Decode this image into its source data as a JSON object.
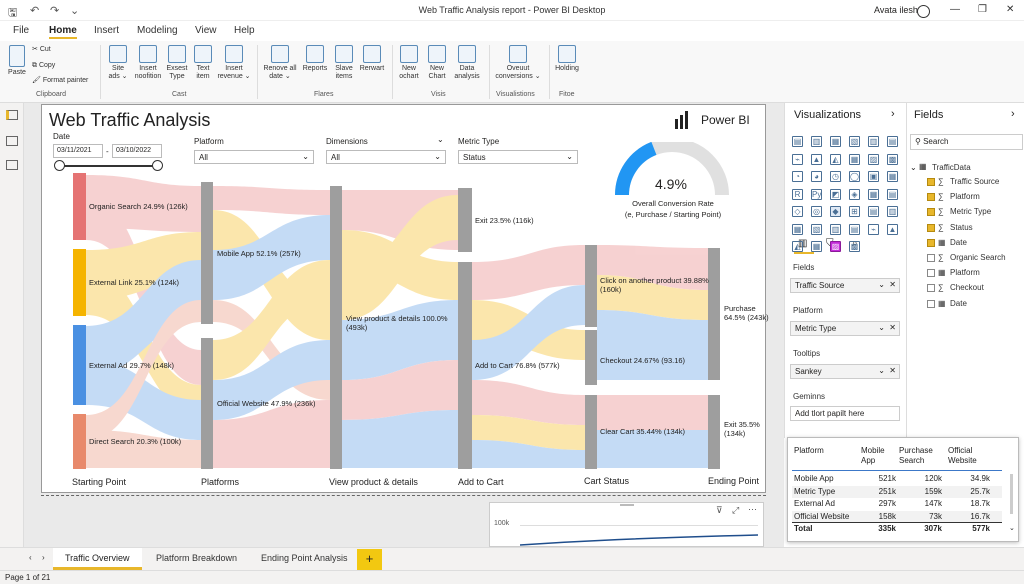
{
  "window": {
    "title": "Web Traffic Analysis report - Power BI Desktop",
    "user": "Avata ilesh"
  },
  "menu": [
    "File",
    "Home",
    "Insert",
    "Modeling",
    "View",
    "Help"
  ],
  "ribbon": {
    "clipboard": {
      "paste": "Paste",
      "cut": "Cut",
      "copy": "Copy",
      "format_painter": "Format painter",
      "group": "Clipboard"
    },
    "cast": [
      {
        "l1": "Site",
        "l2": "ads"
      },
      {
        "l1": "Insert",
        "l2": "noofition"
      },
      {
        "l1": "Exsest",
        "l2": "Type"
      },
      {
        "l1": "Text",
        "l2": "item"
      },
      {
        "l1": "Insert",
        "l2": "revenue"
      }
    ],
    "cast_group": "Cast",
    "flares": [
      {
        "l1": "Renove all",
        "l2": "date"
      },
      {
        "l1": "Reports",
        "l2": ""
      },
      {
        "l1": "Slave",
        "l2": "items"
      },
      {
        "l1": "Rerwart",
        "l2": ""
      }
    ],
    "flares_group": "Flares",
    "visis": [
      {
        "l1": "New",
        "l2": "ochart"
      },
      {
        "l1": "New",
        "l2": "Chart"
      },
      {
        "l1": "Data",
        "l2": "analysis"
      }
    ],
    "visis_group": "Visis",
    "visualistions": {
      "l1": "Oveuut",
      "l2": "conversions",
      "group": "Visualistions"
    },
    "fitoe": {
      "l1": "Holding",
      "group": "Fitoe"
    }
  },
  "report": {
    "title": "Web Traffic Analysis",
    "brand": "Power BI",
    "date_label": "Date",
    "date_from": "03/11/2021",
    "date_to": "03/10/2022",
    "filters": [
      {
        "label": "Platform",
        "value": "All"
      },
      {
        "label": "Dimensions",
        "value": "All"
      },
      {
        "label": "Metric Type",
        "value": "Status"
      }
    ],
    "gauge": {
      "value_text": "4.9%",
      "value": 0.049,
      "caption1": "Overall Conversion Rate",
      "caption2": "(e, Purchase / Starting Point)"
    },
    "stages": [
      "Starting Point",
      "Platforms",
      "View product & details",
      "Add to Cart",
      "Cart Status",
      "Ending Point"
    ],
    "sankey_nodes": {
      "organic": "Organic Search 24.9% (126k)",
      "external_link": "External Link 25.1% (124k)",
      "external_ad": "External Ad 29.7% (148k)",
      "direct": "Direct Search 20.3% (100k)",
      "mobile": "Mobile App 52.1% (257k)",
      "official": "Official Website 47.9% (236k)",
      "view_l1": "View product & details 100.0%",
      "view_l2": "(493k)",
      "exit1": "Exit 23.5% (116k)",
      "add_cart": "Add to Cart 76.8% (577k)",
      "click_l1": "Click on another product 39.88%",
      "click_l2": "(160k)",
      "checkout": "Checkout 24.67% (93.16)",
      "clear": "Clear Cart 35.44% (134k)",
      "purchase_l1": "Purchase",
      "purchase_l2": "64.5% (243k)",
      "exit2_l1": "Exit 35.5%",
      "exit2_l2": "(134k)"
    },
    "colors": {
      "organic": "#e57373",
      "external_link": "#f5b400",
      "external_ad": "#4a90e2",
      "direct": "#e8896b",
      "node": "#9e9e9e",
      "gauge": "#2196f3"
    }
  },
  "mini_chart": {
    "y_tick": "100k"
  },
  "viz_pane": {
    "title": "Visualizations",
    "wells": [
      {
        "label": "Fields",
        "value": "Traffic Source"
      },
      {
        "label": "Platform",
        "value": "Metric Type"
      },
      {
        "label": "Tooltips",
        "value": "Sankey"
      },
      {
        "label": "Geminns",
        "value": "Add tlort papilt here"
      }
    ]
  },
  "fields_pane": {
    "title": "Fields",
    "search_placeholder": "Search",
    "table": "TrafficData",
    "fields": [
      {
        "name": "Traffic Source",
        "checked": true,
        "sigma": true
      },
      {
        "name": "Platform",
        "checked": true,
        "sigma": true
      },
      {
        "name": "Metric Type",
        "checked": true,
        "sigma": true
      },
      {
        "name": "Status",
        "checked": true,
        "sigma": true
      },
      {
        "name": "Date",
        "checked": true,
        "sigma": false
      },
      {
        "name": "Organic Search",
        "checked": false,
        "sigma": true
      },
      {
        "name": "Platform",
        "checked": false,
        "sigma": false
      },
      {
        "name": "Checkout",
        "checked": false,
        "sigma": true
      },
      {
        "name": "Date",
        "checked": false,
        "sigma": false
      }
    ]
  },
  "data_table": {
    "headers": [
      "Platform",
      "Mobile App",
      "Purchase Search",
      "Official Website"
    ],
    "rows": [
      [
        "Mobile App",
        "521k",
        "120k",
        "34.9k"
      ],
      [
        "Metric Type",
        "251k",
        "159k",
        "25.7k"
      ],
      [
        "External Ad",
        "297k",
        "147k",
        "18.7k"
      ],
      [
        "Official Website",
        "158k",
        "73k",
        "16.7k"
      ],
      [
        "Total",
        "335k",
        "307k",
        "577k"
      ]
    ]
  },
  "tabs": [
    "Traffic Overview",
    "Platform Breakdown",
    "Ending Point Analysis"
  ],
  "add_tab": "+",
  "status": "Page 1 of 21"
}
